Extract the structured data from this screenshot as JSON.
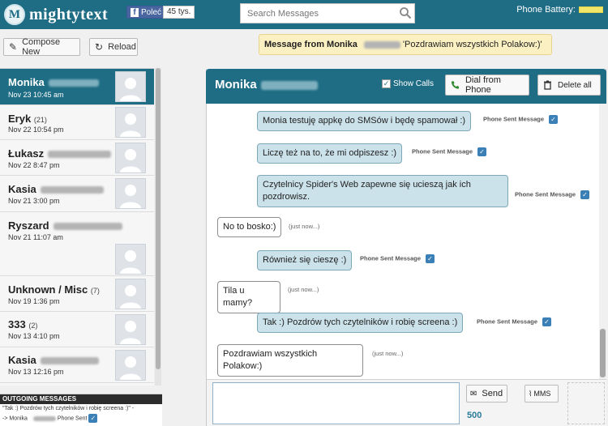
{
  "app": {
    "logo_letter": "M",
    "name": "mightytext",
    "fb_like_label": "Poleć",
    "fb_like_count": "45 tys.",
    "battery_label": "Phone Battery:",
    "battery_level": 1.0
  },
  "search": {
    "placeholder": "Search Messages"
  },
  "toolbar": {
    "compose_label": "Compose New",
    "reload_label": "Reload"
  },
  "notification": {
    "prefix": "Message from Monika",
    "text": "'Pozdrawiam wszystkich Polakow:)'"
  },
  "contacts": [
    {
      "name": "Monika",
      "count": "",
      "date": "Nov 23 10:45 am",
      "active": true
    },
    {
      "name": "Eryk",
      "count": "(21)",
      "date": "Nov 22 10:54 pm",
      "active": false
    },
    {
      "name": "Łukasz",
      "count": "",
      "date": "Nov 22 8:47 pm",
      "active": false
    },
    {
      "name": "Kasia",
      "count": "",
      "date": "Nov 21 3:00 pm",
      "active": false
    },
    {
      "name": "Ryszard",
      "count": "",
      "date": "Nov 21 11:07 am",
      "active": false
    },
    {
      "name": "Unknown / Misc",
      "count": "(7)",
      "date": "Nov 19 1:36 pm",
      "active": false
    },
    {
      "name": "333",
      "count": "(2)",
      "date": "Nov 13 4:10 pm",
      "active": false
    },
    {
      "name": "Kasia",
      "count": "",
      "date": "Nov 13 12:16 pm",
      "active": false
    }
  ],
  "outgoing": {
    "header": "OUTGOING MESSAGES",
    "line1": "\"Tak :) Pozdrów tych czytelników i robię screena :)\" -",
    "line2_prefix": "-> Monika",
    "line2_status": "Phone Sent"
  },
  "conversation": {
    "contact_name": "Monika",
    "show_calls_label": "Show Calls",
    "show_calls_checked": true,
    "dial_label": "Dial from Phone",
    "delete_label": "Delete all",
    "messages": [
      {
        "type": "sent",
        "text": "Monia testuję appkę do SMSów i będę spamował :)",
        "status": "Phone Sent Message"
      },
      {
        "type": "sent",
        "text": "Liczę też na to, że mi odpiszesz :)",
        "status": "Phone Sent Message"
      },
      {
        "type": "sent",
        "text": "Czytelnicy Spider's Web zapewne się ucieszą jak ich pozdrowisz.",
        "status": "Phone Sent Message"
      },
      {
        "type": "recv",
        "text": "No to bosko:)",
        "status": "(just now...)"
      },
      {
        "type": "sent",
        "text": "Również się cieszę :)",
        "status": "Phone Sent Message"
      },
      {
        "type": "recv",
        "text": "Tila u mamy?",
        "status": "(just now...)"
      },
      {
        "type": "sent",
        "text": "Tak :) Pozdrów tych czytelników i robię screena :)",
        "status": "Phone Sent Message"
      },
      {
        "type": "recv",
        "text": "Pozdrawiam wszystkich Polakow:)",
        "status": "(just now...)"
      }
    ]
  },
  "composer": {
    "value": "",
    "send_label": "Send",
    "char_count": "500",
    "mms_label": "MMS"
  },
  "colors": {
    "brand": "#1f6d84",
    "sent_bubble": "#cbe2ea",
    "notification_bg": "#fbf0c1",
    "status_check": "#3a7fb5"
  }
}
